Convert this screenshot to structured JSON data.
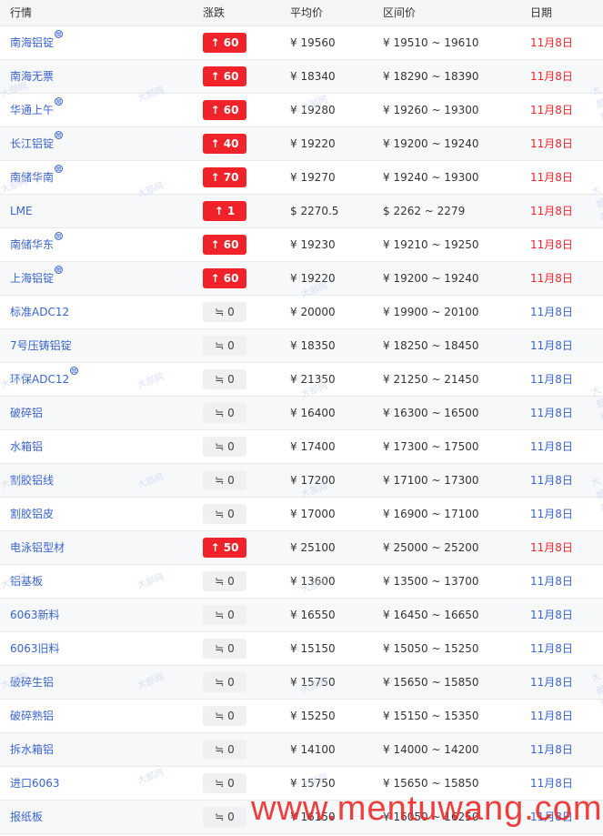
{
  "header": {
    "col_name": "行情",
    "col_change": "涨跌",
    "col_avg": "平均价",
    "col_range": "区间价",
    "col_date": "日期"
  },
  "rows": [
    {
      "name": "南海铝锭",
      "mark": "图",
      "change": "↑ 60",
      "trend": "up",
      "avg": "¥ 19560",
      "range": "¥ 19510 ~ 19610",
      "date": "11月8日",
      "date_color": "red"
    },
    {
      "name": "南海无票",
      "mark": "",
      "change": "↑ 60",
      "trend": "up",
      "avg": "¥ 18340",
      "range": "¥ 18290 ~ 18390",
      "date": "11月8日",
      "date_color": "red"
    },
    {
      "name": "华通上午",
      "mark": "图",
      "change": "↑ 60",
      "trend": "up",
      "avg": "¥ 19280",
      "range": "¥ 19260 ~ 19300",
      "date": "11月8日",
      "date_color": "red"
    },
    {
      "name": "长江铝锭",
      "mark": "图",
      "change": "↑ 40",
      "trend": "up",
      "avg": "¥ 19220",
      "range": "¥ 19200 ~ 19240",
      "date": "11月8日",
      "date_color": "red"
    },
    {
      "name": "南储华南",
      "mark": "图",
      "change": "↑ 70",
      "trend": "up",
      "avg": "¥ 19270",
      "range": "¥ 19240 ~ 19300",
      "date": "11月8日",
      "date_color": "red"
    },
    {
      "name": "LME",
      "mark": "",
      "change": "↑ 1",
      "trend": "up",
      "avg": "$ 2270.5",
      "range": "$ 2262 ~ 2279",
      "date": "11月8日",
      "date_color": "red"
    },
    {
      "name": "南储华东",
      "mark": "图",
      "change": "↑ 60",
      "trend": "up",
      "avg": "¥ 19230",
      "range": "¥ 19210 ~ 19250",
      "date": "11月8日",
      "date_color": "red"
    },
    {
      "name": "上海铝锭",
      "mark": "图",
      "change": "↑ 60",
      "trend": "up",
      "avg": "¥ 19220",
      "range": "¥ 19200 ~ 19240",
      "date": "11月8日",
      "date_color": "red"
    },
    {
      "name": "标准ADC12",
      "mark": "",
      "change": "≒ 0",
      "trend": "flat",
      "avg": "¥ 20000",
      "range": "¥ 19900 ~ 20100",
      "date": "11月8日",
      "date_color": "blue"
    },
    {
      "name": "7号压铸铝锭",
      "mark": "",
      "change": "≒ 0",
      "trend": "flat",
      "avg": "¥ 18350",
      "range": "¥ 18250 ~ 18450",
      "date": "11月8日",
      "date_color": "blue"
    },
    {
      "name": "环保ADC12",
      "mark": "图",
      "change": "≒ 0",
      "trend": "flat",
      "avg": "¥ 21350",
      "range": "¥ 21250 ~ 21450",
      "date": "11月8日",
      "date_color": "blue"
    },
    {
      "name": "破碎铝",
      "mark": "",
      "change": "≒ 0",
      "trend": "flat",
      "avg": "¥ 16400",
      "range": "¥ 16300 ~ 16500",
      "date": "11月8日",
      "date_color": "blue"
    },
    {
      "name": "水箱铝",
      "mark": "",
      "change": "≒ 0",
      "trend": "flat",
      "avg": "¥ 17400",
      "range": "¥ 17300 ~ 17500",
      "date": "11月8日",
      "date_color": "blue"
    },
    {
      "name": "割胶铝线",
      "mark": "",
      "change": "≒ 0",
      "trend": "flat",
      "avg": "¥ 17200",
      "range": "¥ 17100 ~ 17300",
      "date": "11月8日",
      "date_color": "blue"
    },
    {
      "name": "割胶铝皮",
      "mark": "",
      "change": "≒ 0",
      "trend": "flat",
      "avg": "¥ 17000",
      "range": "¥ 16900 ~ 17100",
      "date": "11月8日",
      "date_color": "blue"
    },
    {
      "name": "电泳铝型材",
      "mark": "",
      "change": "↑ 50",
      "trend": "up",
      "avg": "¥ 25100",
      "range": "¥ 25000 ~ 25200",
      "date": "11月8日",
      "date_color": "red"
    },
    {
      "name": "铝基板",
      "mark": "",
      "change": "≒ 0",
      "trend": "flat",
      "avg": "¥ 13600",
      "range": "¥ 13500 ~ 13700",
      "date": "11月8日",
      "date_color": "blue"
    },
    {
      "name": "6063新料",
      "mark": "",
      "change": "≒ 0",
      "trend": "flat",
      "avg": "¥ 16550",
      "range": "¥ 16450 ~ 16650",
      "date": "11月8日",
      "date_color": "blue"
    },
    {
      "name": "6063旧料",
      "mark": "",
      "change": "≒ 0",
      "trend": "flat",
      "avg": "¥ 15150",
      "range": "¥ 15050 ~ 15250",
      "date": "11月8日",
      "date_color": "blue"
    },
    {
      "name": "破碎生铝",
      "mark": "",
      "change": "≒ 0",
      "trend": "flat",
      "avg": "¥ 15750",
      "range": "¥ 15650 ~ 15850",
      "date": "11月8日",
      "date_color": "blue"
    },
    {
      "name": "破碎熟铝",
      "mark": "",
      "change": "≒ 0",
      "trend": "flat",
      "avg": "¥ 15250",
      "range": "¥ 15150 ~ 15350",
      "date": "11月8日",
      "date_color": "blue"
    },
    {
      "name": "拆水箱铝",
      "mark": "",
      "change": "≒ 0",
      "trend": "flat",
      "avg": "¥ 14100",
      "range": "¥ 14000 ~ 14200",
      "date": "11月8日",
      "date_color": "blue"
    },
    {
      "name": "进口6063",
      "mark": "",
      "change": "≒ 0",
      "trend": "flat",
      "avg": "¥ 15750",
      "range": "¥ 15650 ~ 15850",
      "date": "11月8日",
      "date_color": "blue"
    },
    {
      "name": "报纸板",
      "mark": "",
      "change": "≒ 0",
      "trend": "flat",
      "avg": "¥ 16150",
      "range": "¥ 16050 ~ 16250",
      "date": "11月8日",
      "date_color": "blue"
    }
  ],
  "watermark_text": "大部网",
  "site_watermark": "www.mentuwang.com",
  "colors": {
    "up": "#f0232a",
    "flat_bg": "#eff0f2",
    "link": "#3a63c9",
    "header_bg": "#f5f5f7"
  }
}
